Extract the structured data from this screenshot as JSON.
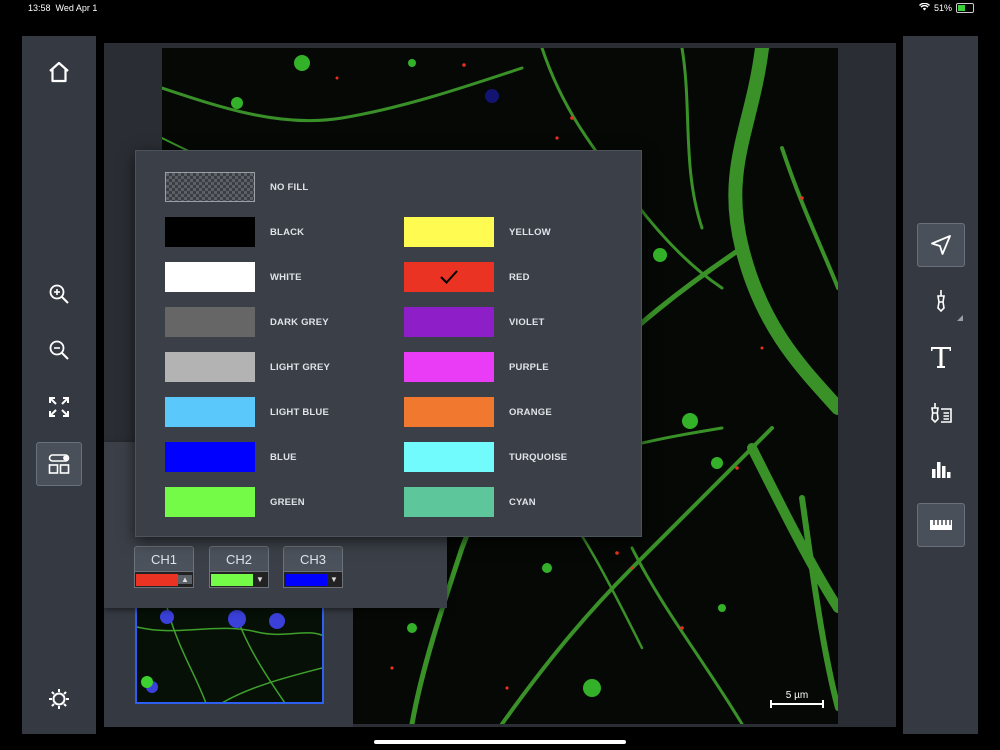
{
  "status_bar": {
    "time": "13:58",
    "date": "Wed Apr 1",
    "battery": "51%",
    "battery_level": 0.51
  },
  "left_toolbar": [
    {
      "icon": "home-icon"
    },
    {
      "icon": "zoom-in-icon"
    },
    {
      "icon": "zoom-out-icon"
    },
    {
      "icon": "fit-to-screen-icon"
    },
    {
      "icon": "channels-layout-icon",
      "active": true
    },
    {
      "icon": "settings-gear-icon"
    }
  ],
  "right_toolbar": [
    {
      "icon": "navigate-arrow-icon",
      "active": true
    },
    {
      "icon": "pen-tool-icon"
    },
    {
      "icon": "text-tool-icon"
    },
    {
      "icon": "annotation-list-icon"
    },
    {
      "icon": "histogram-icon"
    },
    {
      "icon": "ruler-icon",
      "active": true
    }
  ],
  "color_picker": {
    "no_fill": "NO FILL",
    "left_column": [
      {
        "name": "BLACK",
        "color": "#000000"
      },
      {
        "name": "WHITE",
        "color": "#ffffff"
      },
      {
        "name": "DARK GREY",
        "color": "#666666"
      },
      {
        "name": "LIGHT GREY",
        "color": "#b3b3b3"
      },
      {
        "name": "LIGHT BLUE",
        "color": "#5ac8fa"
      },
      {
        "name": "BLUE",
        "color": "#0000ff"
      },
      {
        "name": "GREEN",
        "color": "#73fb47"
      }
    ],
    "right_column": [
      {
        "name": "YELLOW",
        "color": "#fffb50"
      },
      {
        "name": "RED",
        "color": "#ea3323",
        "selected": true
      },
      {
        "name": "VIOLET",
        "color": "#8e1ec8"
      },
      {
        "name": "PURPLE",
        "color": "#ea3bf7"
      },
      {
        "name": "ORANGE",
        "color": "#f0782f"
      },
      {
        "name": "TURQUOISE",
        "color": "#72fbfd"
      },
      {
        "name": "CYAN",
        "color": "#5dc69a"
      }
    ]
  },
  "channels": [
    {
      "label": "CH1",
      "color": "#ea3323",
      "arrow": "▲"
    },
    {
      "label": "CH2",
      "color": "#73fb47",
      "arrow": "▼"
    },
    {
      "label": "CH3",
      "color": "#0000ff",
      "arrow": "▼"
    }
  ],
  "scale_bar": {
    "label": "5  µm"
  }
}
